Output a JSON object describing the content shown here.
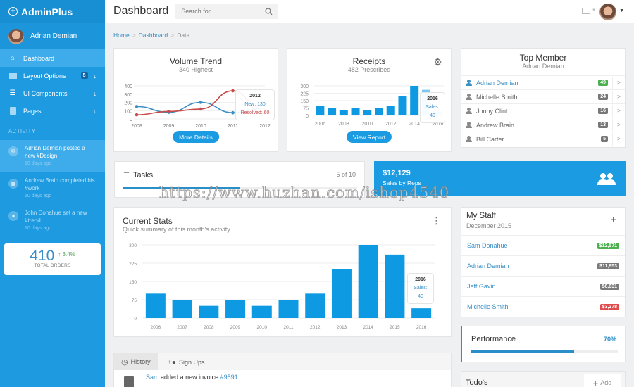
{
  "app": {
    "brand": "AdminPlus"
  },
  "sidebar": {
    "user": {
      "name": "Adrian Demian"
    },
    "items": [
      {
        "label": "Dashboard",
        "icon": "home-icon",
        "active": true
      },
      {
        "label": "Layout Options",
        "icon": "layout-icon",
        "badge": "5",
        "arrow": "↓"
      },
      {
        "label": "UI Components",
        "icon": "sliders-icon",
        "arrow": "↓"
      },
      {
        "label": "Pages",
        "icon": "clipboard-icon",
        "arrow": "↓"
      }
    ],
    "activity_heading": "ACTIVITY",
    "activity": [
      {
        "text": "Adrian Demian posted a new #Design",
        "time": "10 days ago",
        "icon": "mail-icon"
      },
      {
        "text": "Andrew Brain completed his #work",
        "time": "10 days ago",
        "icon": "calendar-icon"
      },
      {
        "text": "John Donahue set a new #trend",
        "time": "10 days ago",
        "icon": "person-icon"
      }
    ],
    "orders": {
      "value": "410",
      "change": "3.4%",
      "label": "TOTAL ORDERS"
    }
  },
  "topbar": {
    "title": "Dashboard",
    "search_placeholder": "Search for..."
  },
  "breadcrumb": [
    "Home",
    "Dashboard",
    "Data"
  ],
  "volume_trend": {
    "title": "Volume Trend",
    "subtitle": "340 Highest",
    "button": "More Details",
    "tooltip": {
      "title": "2012",
      "line1": "New: 130",
      "line2": "Resolved: 60"
    }
  },
  "receipts": {
    "title": "Receipts",
    "subtitle": "482 Prescribed",
    "button": "View Report",
    "tooltip": {
      "title": "2016",
      "line1": "Sales: 40"
    }
  },
  "top_member": {
    "title": "Top Member",
    "subtitle": "Adrian Demian",
    "members": [
      {
        "name": "Adrian Demian",
        "count": "49"
      },
      {
        "name": "Michelle Smith",
        "count": "24"
      },
      {
        "name": "Jonny Clint",
        "count": "16"
      },
      {
        "name": "Andrew Brain",
        "count": "13"
      },
      {
        "name": "Bill Carter",
        "count": "5"
      }
    ]
  },
  "tasks": {
    "title": "Tasks",
    "count": "5 of 10",
    "progress": 0.5
  },
  "sales_reps": {
    "amount": "$12,129",
    "label": "Sales by Reps"
  },
  "current_stats": {
    "title": "Current Stats",
    "subtitle": "Quick summary of this month's activity",
    "tooltip": {
      "title": "2016",
      "line1": "Sales: 40"
    }
  },
  "my_staff": {
    "title": "My Staff",
    "subtitle": "December 2015",
    "staff": [
      {
        "name": "Sam Donahue",
        "amount": "$12,571",
        "color": "#4caf50"
      },
      {
        "name": "Adrian Demian",
        "amount": "$11,953",
        "color": "#7a7a7a"
      },
      {
        "name": "Jeff Gavin",
        "amount": "$6,631",
        "color": "#7a7a7a"
      },
      {
        "name": "Michelle Smith",
        "amount": "$3,278",
        "color": "#e04b4b"
      }
    ]
  },
  "performance": {
    "title": "Performance",
    "value": "70%",
    "fraction": 0.7
  },
  "todos": {
    "title": "Todo's",
    "add": "Add"
  },
  "history": {
    "tabs": [
      "History",
      "Sign Ups"
    ],
    "entry": {
      "user": "Sam",
      "text": "added a new invoice",
      "ref": "#9591"
    }
  },
  "watermark": "https://www.huzhan.com/ishop4540",
  "colors": {
    "accent": "#1b9be1",
    "new": "#3a8fc6",
    "resolved": "#c94b4b"
  },
  "chart_data": [
    {
      "type": "line",
      "title": "Volume Trend",
      "x": [
        "2008",
        "2009",
        "2010",
        "2011",
        "2012"
      ],
      "series": [
        {
          "name": "New",
          "values": [
            150,
            80,
            200,
            75,
            130
          ]
        },
        {
          "name": "Resolved",
          "values": [
            50,
            90,
            120,
            340,
            60
          ]
        }
      ],
      "ylim": [
        0,
        400
      ],
      "yticks": [
        0,
        100,
        200,
        300,
        400
      ],
      "grid": true
    },
    {
      "type": "bar",
      "title": "Receipts",
      "categories": [
        "2006",
        "2007",
        "2008",
        "2009",
        "2010",
        "2011",
        "2012",
        "2013",
        "2014",
        "2015",
        "2016"
      ],
      "xtick_labels": [
        "2006",
        "2008",
        "2010",
        "2012",
        "2014",
        "2016"
      ],
      "values": [
        100,
        75,
        50,
        75,
        50,
        75,
        100,
        200,
        300,
        260,
        40
      ],
      "ylim": [
        0,
        300
      ],
      "yticks": [
        0,
        75,
        150,
        225,
        300
      ],
      "grid": true
    },
    {
      "type": "bar",
      "title": "Current Stats",
      "categories": [
        "2006",
        "2007",
        "2008",
        "2009",
        "2010",
        "2011",
        "2012",
        "2013",
        "2014",
        "2015",
        "2016"
      ],
      "values": [
        100,
        75,
        50,
        75,
        50,
        75,
        100,
        200,
        300,
        260,
        40
      ],
      "ylim": [
        0,
        300
      ],
      "yticks": [
        0,
        75,
        150,
        225,
        300
      ],
      "grid": true
    }
  ]
}
